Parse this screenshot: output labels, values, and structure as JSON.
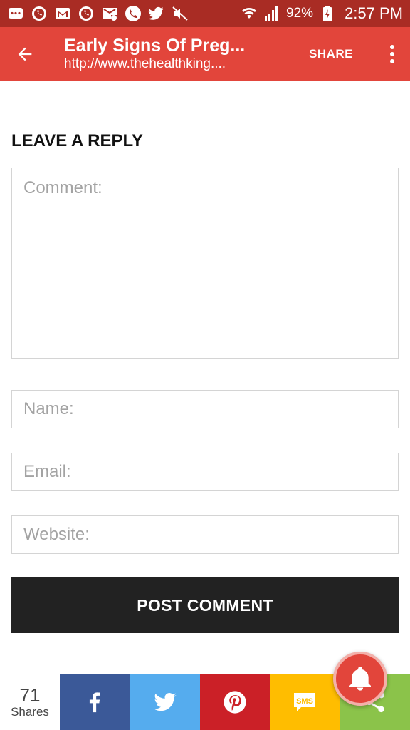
{
  "status_bar": {
    "battery": "92%",
    "time": "2:57 PM",
    "icons": [
      "message-icon",
      "whatsapp-icon",
      "gmail-icon",
      "whatsapp-icon",
      "email-at-icon",
      "phone-icon",
      "twitter-icon",
      "mute-icon",
      "wifi-icon",
      "signal-icon",
      "battery-charging-icon"
    ]
  },
  "app_bar": {
    "title": "Early Signs Of Preg...",
    "url": "http://www.thehealthking....",
    "share_label": "SHARE"
  },
  "reply_form": {
    "heading": "LEAVE A REPLY",
    "comment_placeholder": "Comment:",
    "name_placeholder": "Name:",
    "email_placeholder": "Email:",
    "website_placeholder": "Website:",
    "submit_label": "POST COMMENT"
  },
  "share_bar": {
    "count": "71",
    "count_label": "Shares",
    "sms_label": "SMS",
    "colors": {
      "facebook": "#3b5998",
      "twitter": "#55acee",
      "pinterest": "#cb2027",
      "sms": "#ffbd00",
      "more": "#8bc34a"
    }
  },
  "colors": {
    "status_bar": "#a92c24",
    "app_bar": "#e2453b",
    "button": "#222222"
  }
}
